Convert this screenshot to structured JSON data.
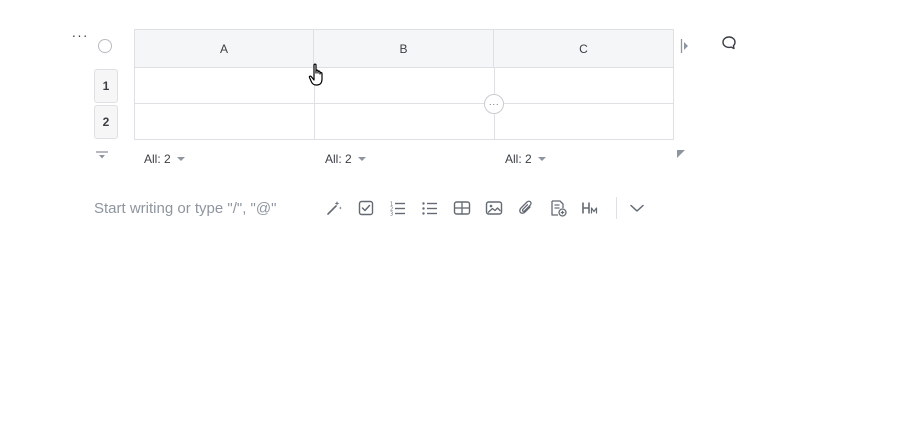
{
  "block": {
    "columns": [
      "A",
      "B",
      "C"
    ],
    "rows": [
      "1",
      "2"
    ],
    "summaries": [
      "All: 2",
      "All: 2",
      "All: 2"
    ],
    "row_more_label": "···"
  },
  "editor": {
    "placeholder": "Start writing or type \"/\", \"@\"",
    "toolbar": [
      "magic-wand-icon",
      "checkbox-icon",
      "ordered-list-icon",
      "bullet-list-icon",
      "table-icon",
      "image-icon",
      "attachment-icon",
      "add-doc-icon",
      "heading-icon",
      "chevron-down-icon"
    ]
  },
  "colors": {
    "border": "#dee0e3",
    "header_bg": "#f5f6f7",
    "text": "#3b3f45",
    "muted": "#8f959e"
  }
}
